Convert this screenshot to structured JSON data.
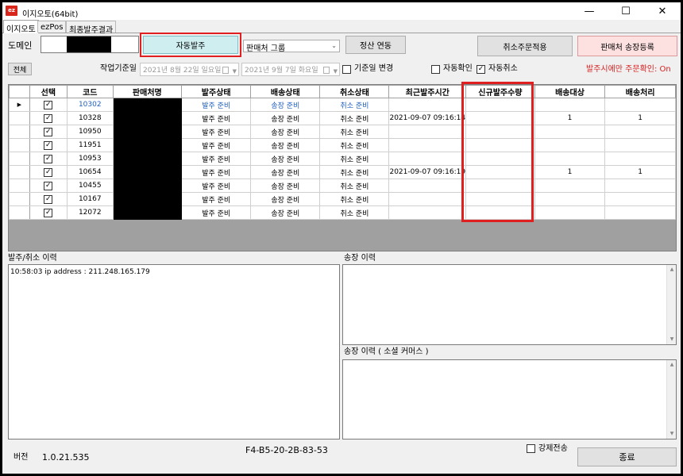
{
  "window": {
    "title": "이지오토(64bit)",
    "app_icon_label": "ez",
    "minimize": "—",
    "maximize": "☐",
    "close": "✕"
  },
  "tabs": [
    "이지오토",
    "ezPos",
    "최종발주결과"
  ],
  "toolbar": {
    "domain_label": "도메인",
    "auto_order_button": "자동발주",
    "seller_group_select": "판매처 그룹",
    "settlement_button": "정산 연동",
    "cancel_order_apply_button": "취소주문적용",
    "seller_invoice_register_button": "판매처 송장등록",
    "all_button": "전체",
    "work_date_label": "작업기준일",
    "date_from": "2021년  8월 22일 일요일",
    "date_to": "2021년  9월  7일 화요일",
    "base_date_change_label": "기준일 변경",
    "auto_confirm_label": "자동확인",
    "auto_cancel_label": "자동취소",
    "order_confirm_notice": "발주시에만 주문확인: On"
  },
  "checkboxes": {
    "base_date_change": false,
    "auto_confirm": false,
    "auto_cancel": true,
    "force_send": false
  },
  "grid": {
    "columns": [
      "선택",
      "코드",
      "판매처명",
      "발주상태",
      "배송상태",
      "취소상태",
      "최근발주시간",
      "신규발주수량",
      "배송대상",
      "배송처리"
    ],
    "rows": [
      {
        "selected": true,
        "code": "10302",
        "seller": "",
        "order_status": "발주 준비",
        "delivery_status": "송장 준비",
        "cancel_status": "취소 준비",
        "last_order_time": "",
        "new_order_qty": "",
        "delivery_target": "",
        "delivery_done": "",
        "highlight": true
      },
      {
        "selected": true,
        "code": "10328",
        "seller": "",
        "order_status": "발주 준비",
        "delivery_status": "송장 준비",
        "cancel_status": "취소 준비",
        "last_order_time": "2021-09-07 09:16:14",
        "new_order_qty": "",
        "delivery_target": "1",
        "delivery_done": "1",
        "highlight": false
      },
      {
        "selected": true,
        "code": "10950",
        "seller": "",
        "order_status": "발주 준비",
        "delivery_status": "송장 준비",
        "cancel_status": "취소 준비",
        "last_order_time": "",
        "new_order_qty": "",
        "delivery_target": "",
        "delivery_done": "",
        "highlight": false
      },
      {
        "selected": true,
        "code": "11951",
        "seller": "",
        "order_status": "발주 준비",
        "delivery_status": "송장 준비",
        "cancel_status": "취소 준비",
        "last_order_time": "",
        "new_order_qty": "",
        "delivery_target": "",
        "delivery_done": "",
        "highlight": false
      },
      {
        "selected": true,
        "code": "10953",
        "seller": "",
        "order_status": "발주 준비",
        "delivery_status": "송장 준비",
        "cancel_status": "취소 준비",
        "last_order_time": "",
        "new_order_qty": "",
        "delivery_target": "",
        "delivery_done": "",
        "highlight": false
      },
      {
        "selected": true,
        "code": "10654",
        "seller": "",
        "order_status": "발주 준비",
        "delivery_status": "송장 준비",
        "cancel_status": "취소 준비",
        "last_order_time": "2021-09-07 09:16:19",
        "new_order_qty": "",
        "delivery_target": "1",
        "delivery_done": "1",
        "highlight": false
      },
      {
        "selected": true,
        "code": "10455",
        "seller": "",
        "order_status": "발주 준비",
        "delivery_status": "송장 준비",
        "cancel_status": "취소 준비",
        "last_order_time": "",
        "new_order_qty": "",
        "delivery_target": "",
        "delivery_done": "",
        "highlight": false
      },
      {
        "selected": true,
        "code": "10167",
        "seller": "",
        "order_status": "발주 준비",
        "delivery_status": "송장 준비",
        "cancel_status": "취소 준비",
        "last_order_time": "",
        "new_order_qty": "",
        "delivery_target": "",
        "delivery_done": "",
        "highlight": false
      },
      {
        "selected": true,
        "code": "12072",
        "seller": "",
        "order_status": "발주 준비",
        "delivery_status": "송장 준비",
        "cancel_status": "취소 준비",
        "last_order_time": "",
        "new_order_qty": "",
        "delivery_target": "",
        "delivery_done": "",
        "highlight": false
      }
    ]
  },
  "logs": {
    "order_cancel_title": "발주/취소 이력",
    "order_cancel_lines": [
      "10:58:03 ip address : 211.248.165.179"
    ],
    "invoice_title": "송장 이력",
    "social_invoice_title": "송장 이력 ( 소셜 커머스 )"
  },
  "footer": {
    "version_label": "버전",
    "version_value": "1.0.21.535",
    "mac_address": "F4-B5-20-2B-83-53",
    "force_send_label": "강제전송",
    "exit_button": "종료"
  },
  "colors": {
    "auto_order_button_bg": "#cfeef0",
    "seller_invoice_button_bg": "#fde0e0",
    "highlight_border": "#e02020",
    "notice_text": "#d92020",
    "link_blue": "#1f5fbf"
  }
}
